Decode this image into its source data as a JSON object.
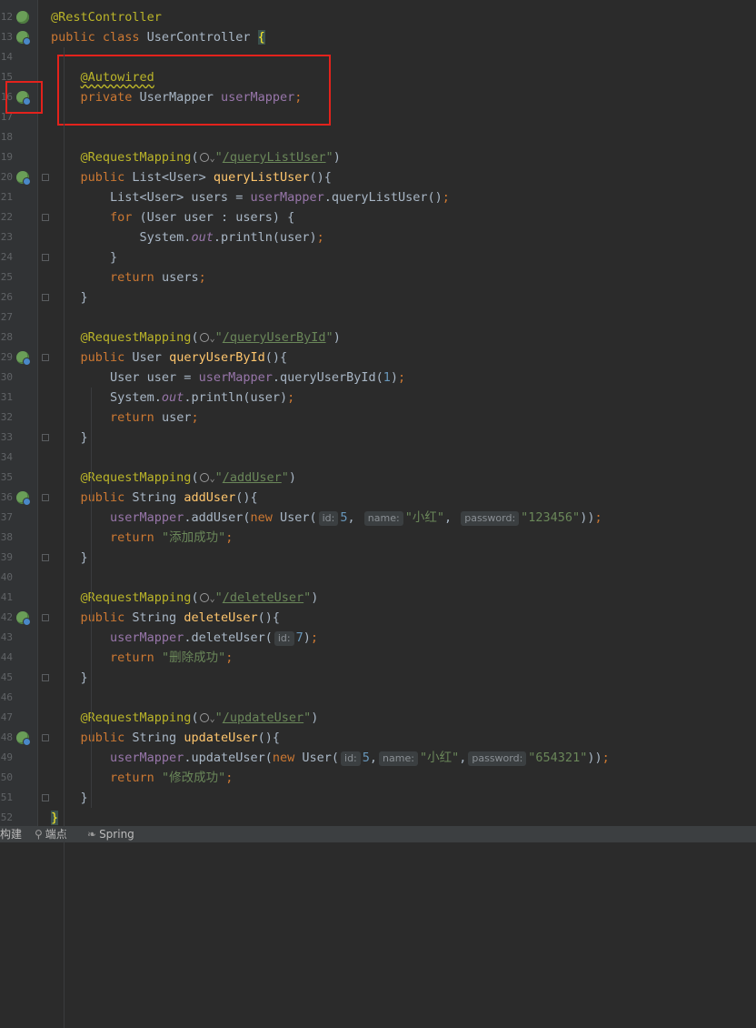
{
  "lines": [
    {
      "n": "12",
      "code": [
        {
          "t": "@RestController",
          "c": "ann"
        }
      ],
      "gutter": "bean"
    },
    {
      "n": "13",
      "code": [
        {
          "t": "public class ",
          "c": "kw"
        },
        {
          "t": "UserController "
        },
        {
          "t": "{",
          "c": "brace-hl"
        }
      ],
      "gutter": "bean-dot"
    },
    {
      "n": "14",
      "code": []
    },
    {
      "n": "15",
      "code": [
        {
          "t": "    "
        },
        {
          "t": "@Autowired",
          "c": "ann wavy"
        }
      ]
    },
    {
      "n": "16",
      "code": [
        {
          "t": "    "
        },
        {
          "t": "private ",
          "c": "kw"
        },
        {
          "t": "UserMapper "
        },
        {
          "t": "userMapper",
          "c": "fld"
        },
        {
          "t": ";",
          "c": "kw"
        }
      ],
      "gutter": "bean-arrow"
    },
    {
      "n": "17",
      "code": []
    },
    {
      "n": "18",
      "code": []
    },
    {
      "n": "19",
      "code": [
        {
          "t": "    "
        },
        {
          "t": "@RequestMapping",
          "c": "ann"
        },
        {
          "t": "("
        },
        {
          "t": "globe"
        },
        {
          "t": "\"",
          "c": "str"
        },
        {
          "t": "/queryListUser",
          "c": "str link"
        },
        {
          "t": "\"",
          "c": "str"
        },
        {
          "t": ")"
        }
      ]
    },
    {
      "n": "20",
      "code": [
        {
          "t": "    "
        },
        {
          "t": "public ",
          "c": "kw"
        },
        {
          "t": "List<User> "
        },
        {
          "t": "queryListUser",
          "c": "fn"
        },
        {
          "t": "(){"
        }
      ],
      "gutter": "bean-dot",
      "fold": "up"
    },
    {
      "n": "21",
      "code": [
        {
          "t": "        List<User> users = "
        },
        {
          "t": "userMapper",
          "c": "fld"
        },
        {
          "t": ".queryListUser()"
        },
        {
          "t": ";",
          "c": "kw"
        }
      ]
    },
    {
      "n": "22",
      "code": [
        {
          "t": "        "
        },
        {
          "t": "for ",
          "c": "kw"
        },
        {
          "t": "(User user : users) {"
        }
      ],
      "fold": "up"
    },
    {
      "n": "23",
      "code": [
        {
          "t": "            System."
        },
        {
          "t": "out",
          "c": "ital"
        },
        {
          "t": ".println(user)"
        },
        {
          "t": ";",
          "c": "kw"
        }
      ]
    },
    {
      "n": "24",
      "code": [
        {
          "t": "        }"
        }
      ],
      "fold": "down"
    },
    {
      "n": "25",
      "code": [
        {
          "t": "        "
        },
        {
          "t": "return ",
          "c": "kw"
        },
        {
          "t": "users"
        },
        {
          "t": ";",
          "c": "kw"
        }
      ]
    },
    {
      "n": "26",
      "code": [
        {
          "t": "    }"
        }
      ],
      "fold": "down"
    },
    {
      "n": "27",
      "code": []
    },
    {
      "n": "28",
      "code": [
        {
          "t": "    "
        },
        {
          "t": "@RequestMapping",
          "c": "ann"
        },
        {
          "t": "("
        },
        {
          "t": "globe"
        },
        {
          "t": "\"",
          "c": "str"
        },
        {
          "t": "/queryUserById",
          "c": "str link"
        },
        {
          "t": "\"",
          "c": "str"
        },
        {
          "t": ")"
        }
      ]
    },
    {
      "n": "29",
      "code": [
        {
          "t": "    "
        },
        {
          "t": "public ",
          "c": "kw"
        },
        {
          "t": "User "
        },
        {
          "t": "queryUserById",
          "c": "fn"
        },
        {
          "t": "(){"
        }
      ],
      "gutter": "bean-dot",
      "fold": "up"
    },
    {
      "n": "30",
      "code": [
        {
          "t": "        User user = "
        },
        {
          "t": "userMapper",
          "c": "fld"
        },
        {
          "t": ".queryUserById("
        },
        {
          "t": "1",
          "c": "num"
        },
        {
          "t": ")"
        },
        {
          "t": ";",
          "c": "kw"
        }
      ]
    },
    {
      "n": "31",
      "code": [
        {
          "t": "        System."
        },
        {
          "t": "out",
          "c": "ital"
        },
        {
          "t": ".println(user)"
        },
        {
          "t": ";",
          "c": "kw"
        }
      ]
    },
    {
      "n": "32",
      "code": [
        {
          "t": "        "
        },
        {
          "t": "return ",
          "c": "kw"
        },
        {
          "t": "user"
        },
        {
          "t": ";",
          "c": "kw"
        }
      ]
    },
    {
      "n": "33",
      "code": [
        {
          "t": "    }"
        }
      ],
      "fold": "down"
    },
    {
      "n": "34",
      "code": []
    },
    {
      "n": "35",
      "code": [
        {
          "t": "    "
        },
        {
          "t": "@RequestMapping",
          "c": "ann"
        },
        {
          "t": "("
        },
        {
          "t": "globe"
        },
        {
          "t": "\"",
          "c": "str"
        },
        {
          "t": "/addUser",
          "c": "str link"
        },
        {
          "t": "\"",
          "c": "str"
        },
        {
          "t": ")"
        }
      ]
    },
    {
      "n": "36",
      "code": [
        {
          "t": "    "
        },
        {
          "t": "public ",
          "c": "kw"
        },
        {
          "t": "String "
        },
        {
          "t": "addUser",
          "c": "fn"
        },
        {
          "t": "(){"
        }
      ],
      "gutter": "bean-dot",
      "fold": "up"
    },
    {
      "n": "37",
      "code": [
        {
          "t": "        "
        },
        {
          "t": "userMapper",
          "c": "fld"
        },
        {
          "t": ".addUser("
        },
        {
          "t": "new ",
          "c": "kw"
        },
        {
          "t": "User("
        },
        {
          "h": "id:"
        },
        {
          "t": "5",
          "c": "num"
        },
        {
          "t": ", "
        },
        {
          "h": "name:"
        },
        {
          "t": "\"小红\"",
          "c": "str"
        },
        {
          "t": ", "
        },
        {
          "h": "password:"
        },
        {
          "t": "\"123456\"",
          "c": "str"
        },
        {
          "t": "))"
        },
        {
          "t": ";",
          "c": "kw"
        }
      ]
    },
    {
      "n": "38",
      "code": [
        {
          "t": "        "
        },
        {
          "t": "return ",
          "c": "kw"
        },
        {
          "t": "\"添加成功\"",
          "c": "str"
        },
        {
          "t": ";",
          "c": "kw"
        }
      ]
    },
    {
      "n": "39",
      "code": [
        {
          "t": "    }"
        }
      ],
      "fold": "down"
    },
    {
      "n": "40",
      "code": []
    },
    {
      "n": "41",
      "code": [
        {
          "t": "    "
        },
        {
          "t": "@RequestMapping",
          "c": "ann"
        },
        {
          "t": "("
        },
        {
          "t": "globe"
        },
        {
          "t": "\"",
          "c": "str"
        },
        {
          "t": "/deleteUser",
          "c": "str link"
        },
        {
          "t": "\"",
          "c": "str"
        },
        {
          "t": ")"
        }
      ]
    },
    {
      "n": "42",
      "code": [
        {
          "t": "    "
        },
        {
          "t": "public ",
          "c": "kw"
        },
        {
          "t": "String "
        },
        {
          "t": "deleteUser",
          "c": "fn"
        },
        {
          "t": "(){"
        }
      ],
      "gutter": "bean-dot",
      "fold": "up"
    },
    {
      "n": "43",
      "code": [
        {
          "t": "        "
        },
        {
          "t": "userMapper",
          "c": "fld"
        },
        {
          "t": ".deleteUser("
        },
        {
          "h": "id:"
        },
        {
          "t": "7",
          "c": "num"
        },
        {
          "t": ")"
        },
        {
          "t": ";",
          "c": "kw"
        }
      ]
    },
    {
      "n": "44",
      "code": [
        {
          "t": "        "
        },
        {
          "t": "return ",
          "c": "kw"
        },
        {
          "t": "\"删除成功\"",
          "c": "str"
        },
        {
          "t": ";",
          "c": "kw"
        }
      ]
    },
    {
      "n": "45",
      "code": [
        {
          "t": "    }"
        }
      ],
      "fold": "down"
    },
    {
      "n": "46",
      "code": []
    },
    {
      "n": "47",
      "code": [
        {
          "t": "    "
        },
        {
          "t": "@RequestMapping",
          "c": "ann"
        },
        {
          "t": "("
        },
        {
          "t": "globe"
        },
        {
          "t": "\"",
          "c": "str"
        },
        {
          "t": "/updateUser",
          "c": "str link"
        },
        {
          "t": "\"",
          "c": "str"
        },
        {
          "t": ")"
        }
      ]
    },
    {
      "n": "48",
      "code": [
        {
          "t": "    "
        },
        {
          "t": "public ",
          "c": "kw"
        },
        {
          "t": "String "
        },
        {
          "t": "updateUser",
          "c": "fn"
        },
        {
          "t": "(){"
        }
      ],
      "gutter": "bean-dot",
      "fold": "up"
    },
    {
      "n": "49",
      "code": [
        {
          "t": "        "
        },
        {
          "t": "userMapper",
          "c": "fld"
        },
        {
          "t": ".updateUser("
        },
        {
          "t": "new ",
          "c": "kw"
        },
        {
          "t": "User("
        },
        {
          "h": "id:"
        },
        {
          "t": "5",
          "c": "num"
        },
        {
          "t": ","
        },
        {
          "h": "name:"
        },
        {
          "t": "\"小红\"",
          "c": "str"
        },
        {
          "t": ","
        },
        {
          "h": "password:"
        },
        {
          "t": "\"654321\"",
          "c": "str"
        },
        {
          "t": "))"
        },
        {
          "t": ";",
          "c": "kw"
        }
      ]
    },
    {
      "n": "50",
      "code": [
        {
          "t": "        "
        },
        {
          "t": "return ",
          "c": "kw"
        },
        {
          "t": "\"修改成功\"",
          "c": "str"
        },
        {
          "t": ";",
          "c": "kw"
        }
      ]
    },
    {
      "n": "51",
      "code": [
        {
          "t": "    }"
        }
      ],
      "fold": "down"
    },
    {
      "n": "52",
      "code": [
        {
          "t": "}",
          "c": "brace-hl"
        }
      ]
    }
  ],
  "statusbar": {
    "build_label": "构建",
    "breakpoints_label": "端点",
    "spring_label": "Spring"
  },
  "colors": {
    "background": "#2b2b2b",
    "keyword": "#cc7832",
    "annotation": "#bbb529",
    "string": "#6a8759",
    "highlight_box": "#e3221c"
  }
}
